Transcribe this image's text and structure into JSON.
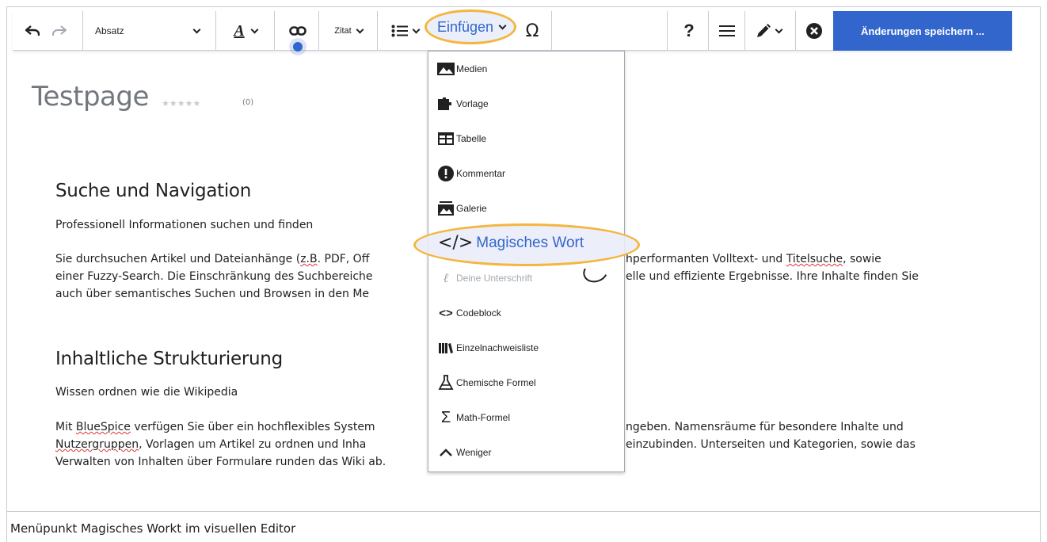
{
  "toolbar": {
    "undo_icon": "undo-icon",
    "redo_icon": "redo-icon",
    "paragraph_select": "Absatz",
    "text_style_icon": "text-style-icon",
    "link_icon": "link-icon",
    "cite_label": "Zitat",
    "list_icon": "bullet-list-icon",
    "insert_label": "Einfügen",
    "special_char_symbol": "Ω",
    "help_symbol": "?",
    "save_label": "Änderungen speichern ..."
  },
  "page": {
    "title": "Testpage",
    "stars": "★★★★★",
    "rating_count": "(0)"
  },
  "sections": [
    {
      "heading": "Suche und Navigation",
      "subheading": "Professionell Informationen suchen und finden",
      "lines": [
        [
          "Sie durchsuchen Artikel und Dateianhänge (",
          "z.B",
          ". PDF, Off",
          "",
          "hperformanten Volltext- und ",
          "Titelsuche",
          ", sowie"
        ],
        [
          "einer Fuzzy-Search. Die Einschränkung des Suchbereiche",
          "",
          "",
          "",
          "elle und effiziente Ergebnisse. Ihre Inhalte finden Sie",
          "",
          ""
        ],
        [
          "auch über semantisches Suchen und Browsen in den Me",
          "",
          "",
          "",
          "",
          "",
          ""
        ]
      ]
    },
    {
      "heading": "Inhaltliche Strukturierung",
      "subheading": "Wissen ordnen wie die Wikipedia",
      "lines": [
        [
          "Mit ",
          "BlueSpice",
          " verfügen Sie über ein hochflexibles System",
          "",
          "ngeben. Namensräume für besondere Inhalte und",
          "",
          ""
        ],
        [
          "",
          "Nutzergruppen",
          ", Vorlagen um Artikel zu ordnen und Inha",
          "",
          "einzubinden. Unterseiten und Kategorien, sowie das",
          "",
          ""
        ],
        [
          "Verwalten von Inhalten über Formulare runden das Wiki ab.",
          "",
          "",
          "",
          "",
          "",
          ""
        ]
      ]
    }
  ],
  "insert_menu": {
    "items": [
      {
        "label": "Medien",
        "icon": "image-icon"
      },
      {
        "label": "Vorlage",
        "icon": "puzzle-icon"
      },
      {
        "label": "Tabelle",
        "icon": "table-icon"
      },
      {
        "label": "Kommentar",
        "icon": "alert-icon"
      },
      {
        "label": "Galerie",
        "icon": "gallery-icon"
      },
      {
        "label": "Magisches Wort",
        "icon": "code-slash-icon"
      },
      {
        "label": "Deine Unterschrift",
        "icon": "signature-icon"
      },
      {
        "label": "Codeblock",
        "icon": "code-icon"
      },
      {
        "label": "Einzelnachweisliste",
        "icon": "references-icon"
      },
      {
        "label": "Chemische Formel",
        "icon": "flask-icon"
      },
      {
        "label": "Math-Formel",
        "icon": "sigma-icon"
      },
      {
        "label": "Weniger",
        "icon": "chevron-up-icon"
      }
    ]
  },
  "caption": "Menüpunkt Magisches Workt im visuellen Editor",
  "colors": {
    "accent": "#3366cc",
    "highlight": "#f4b63f"
  }
}
